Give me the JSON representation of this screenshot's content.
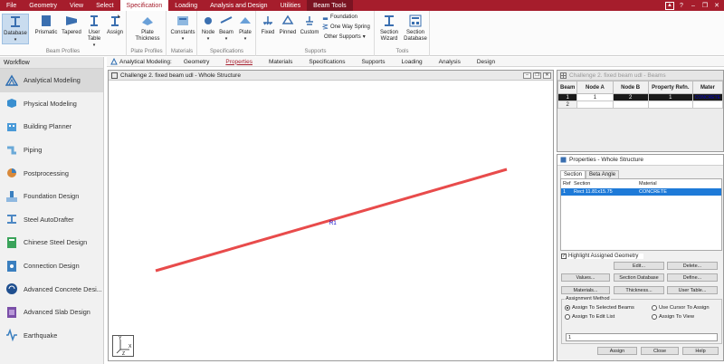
{
  "menu": {
    "tabs": [
      "File",
      "Geometry",
      "View",
      "Select",
      "Specification",
      "Loading",
      "Analysis and Design",
      "Utilities",
      "Beam Tools"
    ],
    "active_index": 4
  },
  "ribbon": {
    "beam_profiles": {
      "label": "Beam Profiles",
      "buttons": [
        "Database",
        "Prismatic",
        "Tapered",
        "User Table",
        "Assign"
      ]
    },
    "plate_profiles": {
      "label": "Plate Profiles",
      "buttons": [
        "Plate Thickness"
      ]
    },
    "materials": {
      "label": "Materials",
      "buttons": [
        "Constants"
      ]
    },
    "specifications": {
      "label": "Specifications",
      "buttons": [
        "Node",
        "Beam",
        "Plate"
      ]
    },
    "supports": {
      "label": "Supports",
      "buttons": [
        "Fixed",
        "Pinned",
        "Custom"
      ],
      "small": [
        "Foundation",
        "One Way Spring",
        "Other Supports"
      ]
    },
    "tools": {
      "label": "Tools",
      "buttons": [
        "Section Wizard",
        "Section Database"
      ]
    }
  },
  "workflow": {
    "title": "Workflow",
    "items": [
      {
        "label": "Analytical Modeling",
        "color": "#2f6fb3"
      },
      {
        "label": "Physical Modeling",
        "color": "#3a8fd0"
      },
      {
        "label": "Building Planner",
        "color": "#4a9ad8"
      },
      {
        "label": "Piping",
        "color": "#6aa9d8"
      },
      {
        "label": "Postprocessing",
        "color": "#d8893a"
      },
      {
        "label": "Foundation Design",
        "color": "#3a7fbf"
      },
      {
        "label": "Steel AutoDrafter",
        "color": "#4d88c4"
      },
      {
        "label": "Chinese Steel Design",
        "color": "#3aa35a"
      },
      {
        "label": "Connection Design",
        "color": "#3a7fbf"
      },
      {
        "label": "Advanced Concrete Desi...",
        "color": "#1f4f8f"
      },
      {
        "label": "Advanced Slab Design",
        "color": "#7a4fa8"
      },
      {
        "label": "Earthquake",
        "color": "#3a7fbf"
      }
    ]
  },
  "analytical_nav": {
    "lead": "Analytical Modeling:",
    "items": [
      "Geometry",
      "Properties",
      "Materials",
      "Specifications",
      "Supports",
      "Loading",
      "Analysis",
      "Design"
    ],
    "active_index": 1
  },
  "structure_window": {
    "title": "Challenge 2. fixed beam udl - Whole Structure",
    "beam_label": "R1",
    "beam_color": "#e84b4b",
    "axis_labels": [
      "Y",
      "X",
      "Z"
    ]
  },
  "beams_window": {
    "title": "Challenge 2. fixed beam udl - Beams",
    "columns": [
      "Beam",
      "Node A",
      "Node B",
      "Property Refn.",
      "Mater"
    ],
    "rows": [
      [
        "1",
        "1",
        "2",
        "1",
        "CONCRETE"
      ],
      [
        "2",
        "",
        "",
        "",
        ""
      ]
    ]
  },
  "properties_window": {
    "title": "Properties - Whole Structure",
    "tabs": [
      "Section",
      "Beta Angle"
    ],
    "list_headers": [
      "Ref",
      "Section",
      "Material"
    ],
    "list_rows": [
      [
        "1",
        "Rect 11.81x15.75",
        "CONCRETE"
      ]
    ],
    "highlight_label": "Highlight Assigned Geometry",
    "buttons_row1": [
      "Edit...",
      "Delete..."
    ],
    "buttons_row2": [
      "Values...",
      "Section Database",
      "Define..."
    ],
    "buttons_row3": [
      "Materials...",
      "Thickness...",
      "User Table..."
    ],
    "assignment": {
      "label": "Assignment Method",
      "options": [
        "Assign To Selected Beams",
        "Use Cursor To Assign",
        "Assign To Edit List",
        "Assign To View"
      ],
      "selected_index": 0,
      "edit_value": "1"
    },
    "footer_buttons": [
      "Assign",
      "Close",
      "Help"
    ]
  }
}
